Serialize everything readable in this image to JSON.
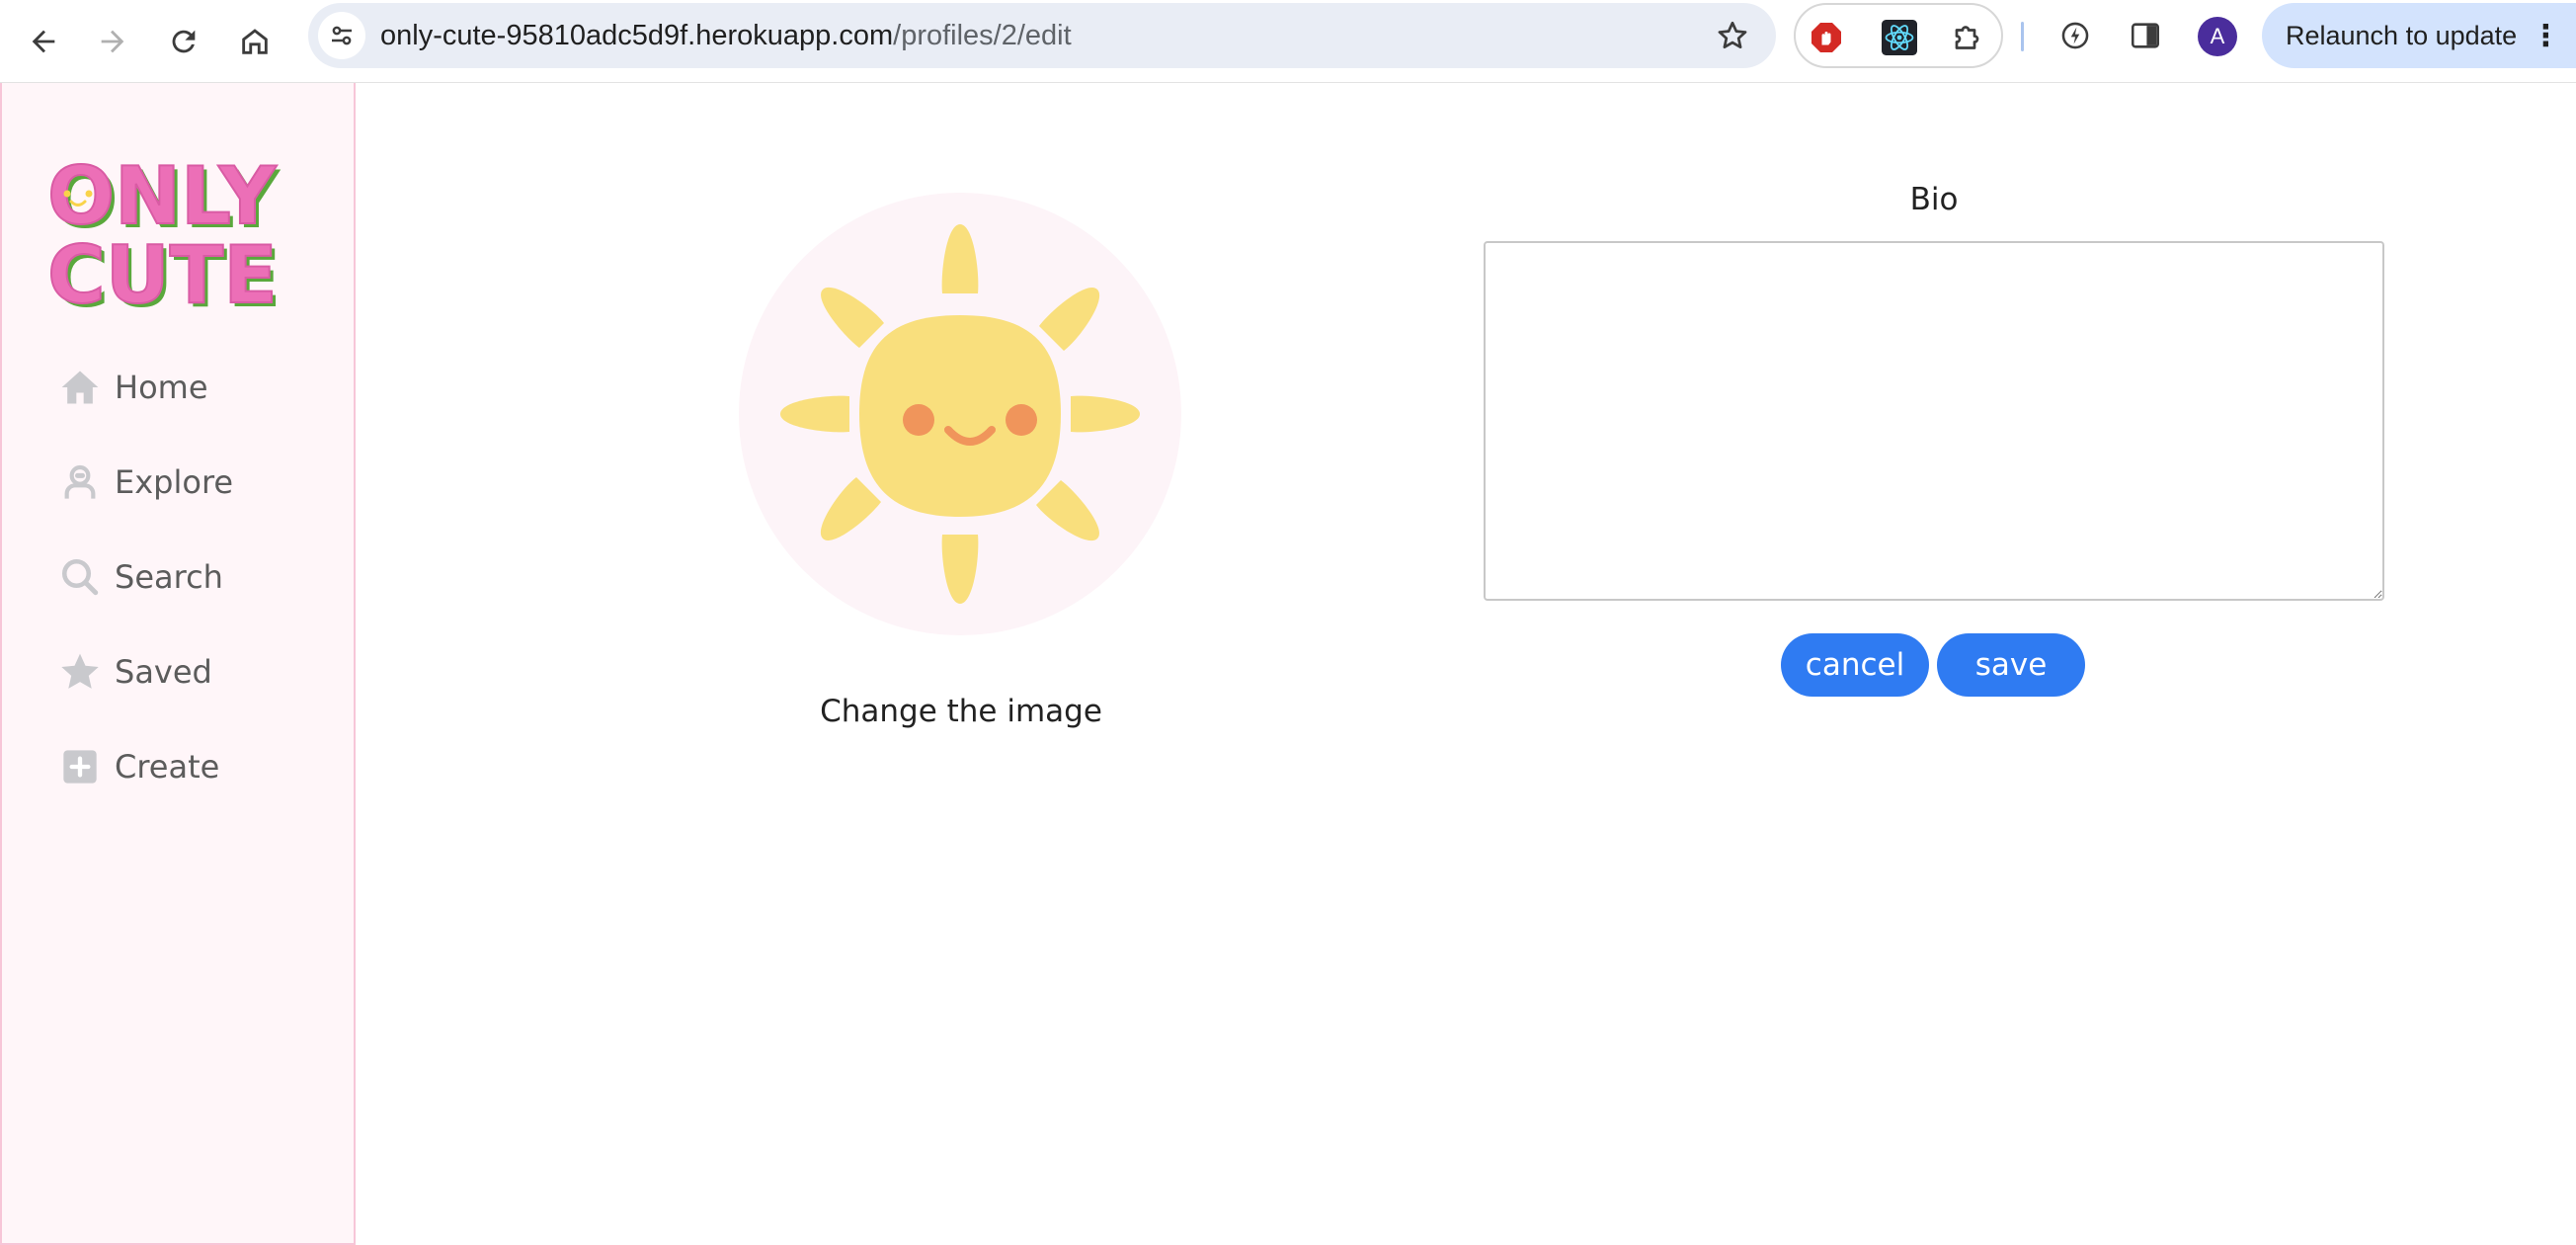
{
  "browser": {
    "url_host": "only-cute-95810adc5d9f.herokuapp.com",
    "url_path": "/profiles/2/edit",
    "relaunch_label": "Relaunch to update",
    "profile_initial": "A"
  },
  "sidebar": {
    "logo_text": [
      "ONLY",
      "CUTE"
    ],
    "items": [
      {
        "label": "Home",
        "icon": "home-icon"
      },
      {
        "label": "Explore",
        "icon": "explore-icon"
      },
      {
        "label": "Search",
        "icon": "search-icon"
      },
      {
        "label": "Saved",
        "icon": "star-icon"
      },
      {
        "label": "Create",
        "icon": "plus-square-icon"
      }
    ]
  },
  "profile_edit": {
    "change_image_label": "Change the image",
    "bio_label": "Bio",
    "bio_value": "",
    "cancel_label": "cancel",
    "save_label": "save"
  },
  "colors": {
    "accent": "#2f7bf2",
    "logo_pink": "#ec6fb7",
    "logo_green": "#5aa83c",
    "sidebar_bg": "#fff6f9",
    "sun_yellow": "#f9df7d"
  }
}
